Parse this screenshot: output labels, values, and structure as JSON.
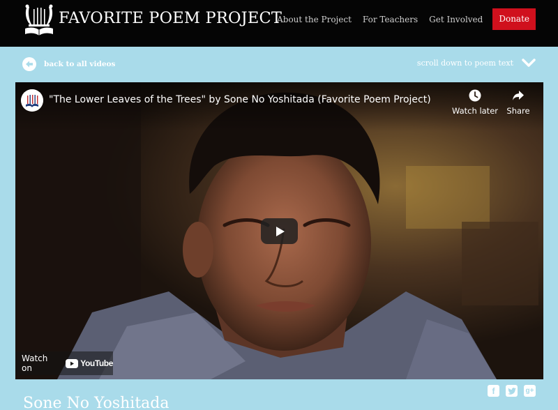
{
  "header": {
    "site_title": "FAVORITE POEM PROJECT",
    "nav": {
      "about": "About the Project",
      "teachers": "For Teachers",
      "involved": "Get Involved",
      "donate": "Donate"
    }
  },
  "subbar": {
    "back_label": "back to all videos",
    "scroll_label": "scroll down to poem text"
  },
  "video": {
    "title": "\"The Lower Leaves of the Trees\" by Sone No Yoshitada (Favorite Poem Project)",
    "watch_later": "Watch later",
    "share": "Share",
    "watch_on": "Watch on",
    "youtube": "YouTube"
  },
  "social": {
    "facebook_icon": "facebook-icon",
    "twitter_icon": "twitter-icon",
    "googleplus_icon": "googleplus-icon"
  },
  "reader_name": "Sone No Yoshitada",
  "colors": {
    "header_bg": "#050505",
    "page_bg": "#a9dbea",
    "donate": "#d0101d"
  }
}
